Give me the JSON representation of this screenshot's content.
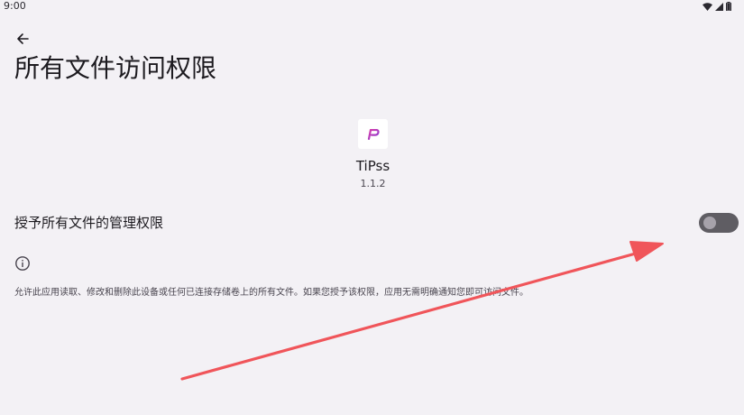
{
  "status_bar": {
    "time": "9:00",
    "icons": [
      "wifi-icon",
      "cellular-signal-icon",
      "battery-icon"
    ]
  },
  "header": {
    "back_icon": "arrow-back-icon",
    "title": "所有文件访问权限"
  },
  "app": {
    "icon": "tipss-app-icon",
    "icon_glyph": "P",
    "name": "TiPss",
    "version": "1.1.2"
  },
  "permission": {
    "label": "授予所有文件的管理权限",
    "enabled": false
  },
  "info": {
    "icon": "info-icon",
    "text": "允许此应用读取、修改和删除此设备或任何已连接存储卷上的所有文件。如果您授予该权限，应用无需明确通知您即可访问文件。"
  },
  "colors": {
    "background": "#f3f1f5",
    "toggle_track": "#5f5d63",
    "toggle_thumb": "#a6a2aa",
    "annotation_arrow": "#f0555a",
    "app_icon_accent": "#d63aa8"
  }
}
